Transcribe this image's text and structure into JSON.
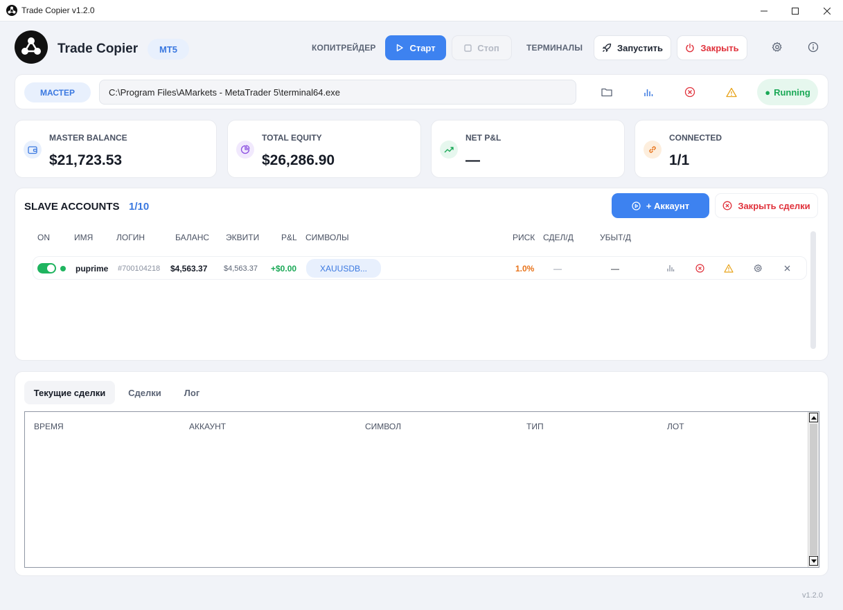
{
  "window": {
    "title": "Trade Copier v1.2.0"
  },
  "header": {
    "app_name": "Trade Copier",
    "platform_badge": "MT5",
    "nav_copytrader": "КОПИТРЕЙДЕР",
    "start_label": "Старт",
    "stop_label": "Стоп",
    "nav_terminals": "ТЕРМИНАЛЫ",
    "launch_label": "Запустить",
    "close_label": "Закрыть"
  },
  "master": {
    "label": "МАСТЕР",
    "path": "C:\\Program Files\\AMarkets - MetaTrader 5\\terminal64.exe",
    "status": "Running",
    "status_color": "#1aa856"
  },
  "stats": [
    {
      "label": "MASTER BALANCE",
      "value": "$21,723.53",
      "icon": "wallet-icon",
      "color": "#3a78e0"
    },
    {
      "label": "TOTAL EQUITY",
      "value": "$26,286.90",
      "icon": "pie-chart-icon",
      "color": "#8b4fe0"
    },
    {
      "label": "NET P&L",
      "value": "—",
      "icon": "trend-up-icon",
      "color": "#1aa856"
    },
    {
      "label": "CONNECTED",
      "value": "1/1",
      "icon": "link-icon",
      "color": "#e8731a"
    }
  ],
  "slaves": {
    "title": "SLAVE ACCOUNTS",
    "count": "1/10",
    "add_label": "+ Аккаунт",
    "close_trades_label": "Закрыть сделки",
    "columns": [
      "ON",
      "ИМЯ",
      "ЛОГИН",
      "БАЛАНС",
      "ЭКВИТИ",
      "P&L",
      "СИМВОЛЫ",
      "РИСК",
      "СДЕЛ/Д",
      "УБЫТ/Д"
    ],
    "rows": [
      {
        "name": "puprime",
        "login": "#700104218",
        "balance": "$4,563.37",
        "equity": "$4,563.37",
        "pnl": "+$0.00",
        "symbols": "XAUUSDB...",
        "risk": "1.0%",
        "deals_day": "—",
        "loss_day": "—"
      }
    ]
  },
  "tabs": {
    "items": [
      "Текущие сделки",
      "Сделки",
      "Лог"
    ],
    "columns": [
      "ВРЕМЯ",
      "АККАУНТ",
      "СИМВОЛ",
      "ТИП",
      "ЛОТ"
    ]
  },
  "footer": {
    "version": "v1.2.0"
  },
  "colors": {
    "accent": "#3d82f0",
    "danger": "#e0313b",
    "success": "#1fb45f",
    "warning": "#e8a31a"
  }
}
